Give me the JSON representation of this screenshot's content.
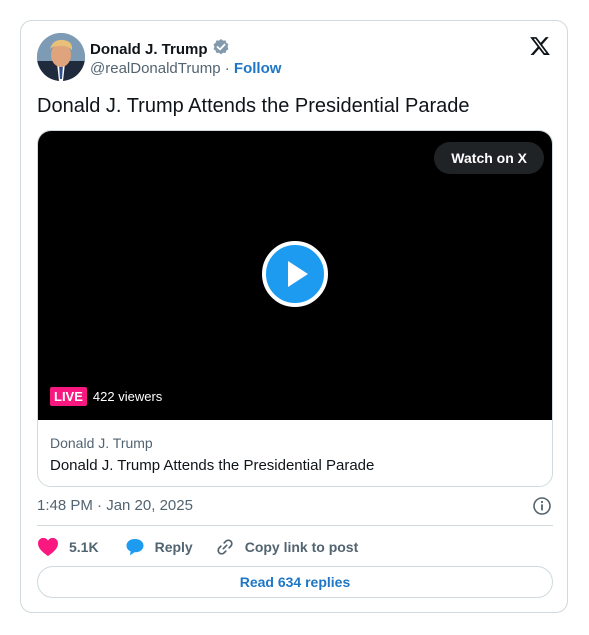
{
  "author": {
    "display_name": "Donald J. Trump",
    "handle": "@realDonaldTrump",
    "separator": "·",
    "follow_label": "Follow",
    "verified_color": "#829aab"
  },
  "tweet": {
    "text": "Donald J. Trump Attends the Presidential Parade",
    "timestamp": "1:48 PM · Jan 20, 2025"
  },
  "media": {
    "watch_label": "Watch on X",
    "live_label": "LIVE",
    "viewers": "422 viewers",
    "source": "Donald J. Trump",
    "title": "Donald J. Trump Attends the Presidential Parade"
  },
  "actions": {
    "likes": "5.1K",
    "reply_label": "Reply",
    "copy_link_label": "Copy link to post",
    "read_replies_label": "Read 634 replies"
  },
  "colors": {
    "accent": "#1d9bf0",
    "like": "#f91880",
    "live": "#f91880",
    "link": "#1d77c6"
  },
  "icons": [
    "verified-badge-icon",
    "x-logo-icon",
    "play-icon",
    "info-icon",
    "heart-icon",
    "reply-bubble-icon",
    "link-icon"
  ]
}
